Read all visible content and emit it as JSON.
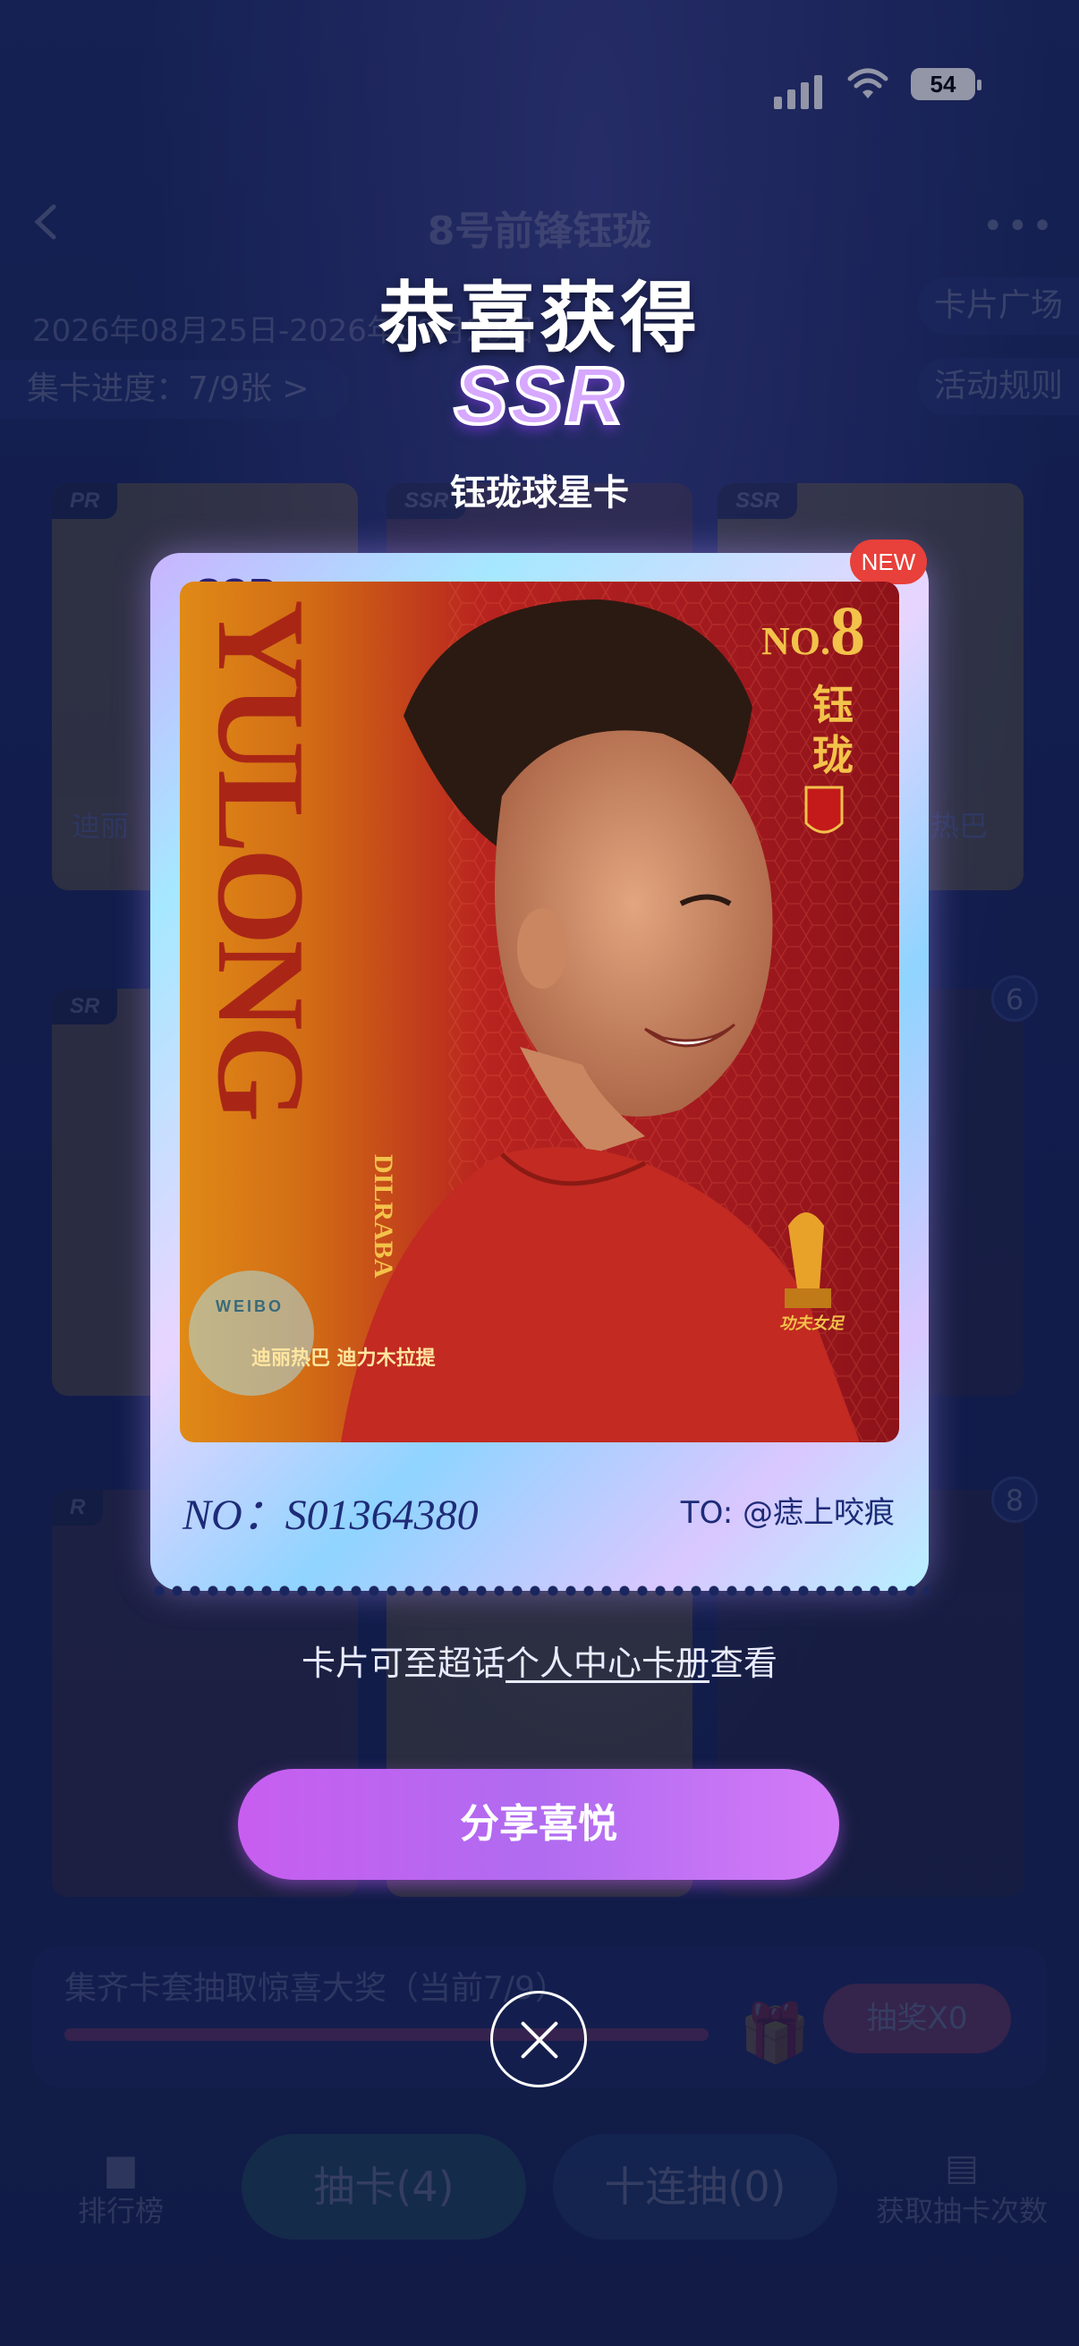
{
  "status": {
    "battery": "54"
  },
  "underlying": {
    "title": "8号前锋钰珑",
    "date_range": "2026年08月25日-2026年09月25日",
    "progress_label": "集卡进度：7/9张 >",
    "card_square": "卡片广场",
    "rules": "活动规则",
    "levels": [
      "PR",
      "SSR",
      "SSR",
      "SR",
      "R"
    ],
    "captions": [
      "迪丽",
      "热巴"
    ],
    "badges": [
      "6",
      "8"
    ],
    "prize_text": "集齐卡套抽取惊喜大奖（当前7/9）",
    "prize_button": "抽奖X0",
    "nav": {
      "rank": "排行榜",
      "draw": "抽卡(4)",
      "ten_draw": "十连抽(0)",
      "get_draws": "获取抽卡次数"
    }
  },
  "modal": {
    "congrats": "恭喜获得",
    "rarity": "SSR",
    "card_name": "钰珑球星卡",
    "frame_rarity": "SSR",
    "new_badge": "NEW",
    "photo": {
      "big_text": "YULONG",
      "no_label": "NO.",
      "number": "8",
      "player_name": "钰珑",
      "sub_name": "DILRABA",
      "caption": "迪丽热巴 迪力木拉提",
      "watermark": "WEIBO",
      "trophy_text": "功夫女足"
    },
    "serial": "NO：S01364380",
    "to_user": "TO: @痣上咬痕",
    "hint_prefix": "卡片可至超话",
    "hint_link": "个人中心卡册",
    "hint_suffix": "查看",
    "share_button": "分享喜悦"
  },
  "colors": {
    "accent_purple": "#c85ef0",
    "new_red": "#e8403a",
    "background": "#17245a"
  }
}
